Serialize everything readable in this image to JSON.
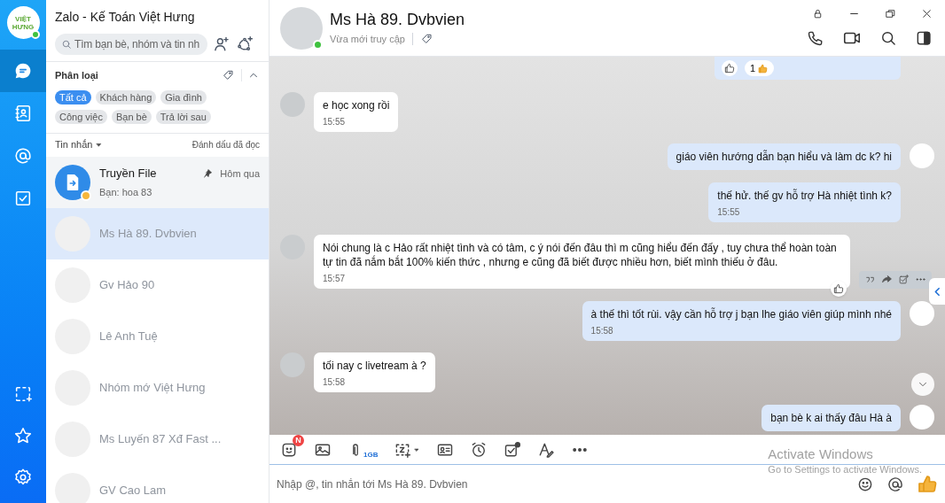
{
  "rail": {
    "logo_text": "VIỆT HƯNG",
    "online": true,
    "items": [
      {
        "kind": "chat",
        "selected": true
      },
      {
        "kind": "contacts",
        "selected": false
      },
      {
        "kind": "mention",
        "selected": false
      },
      {
        "kind": "todo",
        "selected": false
      }
    ],
    "bottom_items": [
      {
        "kind": "capture"
      },
      {
        "kind": "star"
      },
      {
        "kind": "settings"
      }
    ]
  },
  "sidebar": {
    "title": "Zalo - Kế Toán Việt Hưng",
    "search": {
      "placeholder": "Tìm bạn bè, nhóm và tin nh"
    },
    "filter": {
      "label": "Phân loại",
      "expanded": true,
      "tags": [
        {
          "label": "Tất cả",
          "selected": true
        },
        {
          "label": "Khách hàng",
          "selected": false
        },
        {
          "label": "Gia đình",
          "selected": false
        },
        {
          "label": "Công việc",
          "selected": false
        },
        {
          "label": "Bạn bè",
          "selected": false
        },
        {
          "label": "Trả lời sau",
          "selected": false
        }
      ]
    },
    "list_header": {
      "label": "Tin nhắn",
      "action": "Đánh dấu đã đọc"
    },
    "conversations": [
      {
        "name": "Truyền File",
        "preview": "Bạn: hoa 83",
        "time": "Hôm qua",
        "pinned": true,
        "faded": false,
        "selected": false
      },
      {
        "name": "Ms Hà 89. Dvbvien",
        "faded": true,
        "selected": true
      },
      {
        "name": "Gv Hảo 90",
        "faded": true,
        "selected": false
      },
      {
        "name": "Lê Anh Tuệ",
        "faded": true,
        "selected": false
      },
      {
        "name": "Nhóm mớ Việt Hưng",
        "faded": true,
        "selected": false
      },
      {
        "name": "Ms Luyến 87 Xđ Fast ...",
        "faded": true,
        "selected": false
      },
      {
        "name": "GV Cao Lam",
        "faded": true,
        "selected": false
      }
    ]
  },
  "chat": {
    "name": "Ms Hà 89. Dvbvien",
    "status": "Vừa mới truy cập",
    "online": true,
    "messages": [
      {
        "kind": "reactions",
        "from_me": true,
        "count": "1"
      },
      {
        "kind": "text",
        "from_me": false,
        "text": "e học xong rồi",
        "time": "15:55"
      },
      {
        "kind": "text",
        "from_me": true,
        "text": "giáo viên hướng dẫn bạn hiểu và làm dc k? hi",
        "avatar": true
      },
      {
        "kind": "text",
        "from_me": true,
        "text": "thế hử. thế gv hỗ trợ Hà nhiệt tình k?",
        "time": "15:55"
      },
      {
        "kind": "text",
        "from_me": false,
        "text": "Nói chung là c Hảo rất nhiệt tình và có tâm, c ý nói đến đâu thì m cũng hiểu đến đấy , tuy chưa thể hoàn toàn tự tin đã nắm bắt 100% kiến thức , nhưng e cũng đã biết được nhiều hơn, biết mình thiếu ở đâu.",
        "time": "15:57",
        "actions": true
      },
      {
        "kind": "text",
        "from_me": true,
        "text": "à thế thì tốt rùi. vậy cần hỗ trợ j bạn lhe giáo viên giúp mình nhé",
        "time": "15:58",
        "avatar": true
      },
      {
        "kind": "text",
        "from_me": false,
        "text": "tối nay c livetream à ?",
        "time": "15:58"
      },
      {
        "kind": "text",
        "from_me": true,
        "text": "bạn bè k ai thấy đâu Hà à",
        "avatar": true
      }
    ]
  },
  "composer": {
    "emoji_badge": "N",
    "file_limit": "1GB",
    "placeholder": "Nhập @, tin nhắn tới Ms Hà 89. Dvbvien"
  },
  "os_notice": {
    "title": "Activate Windows",
    "subtitle": "Go to Settings to activate Windows."
  }
}
